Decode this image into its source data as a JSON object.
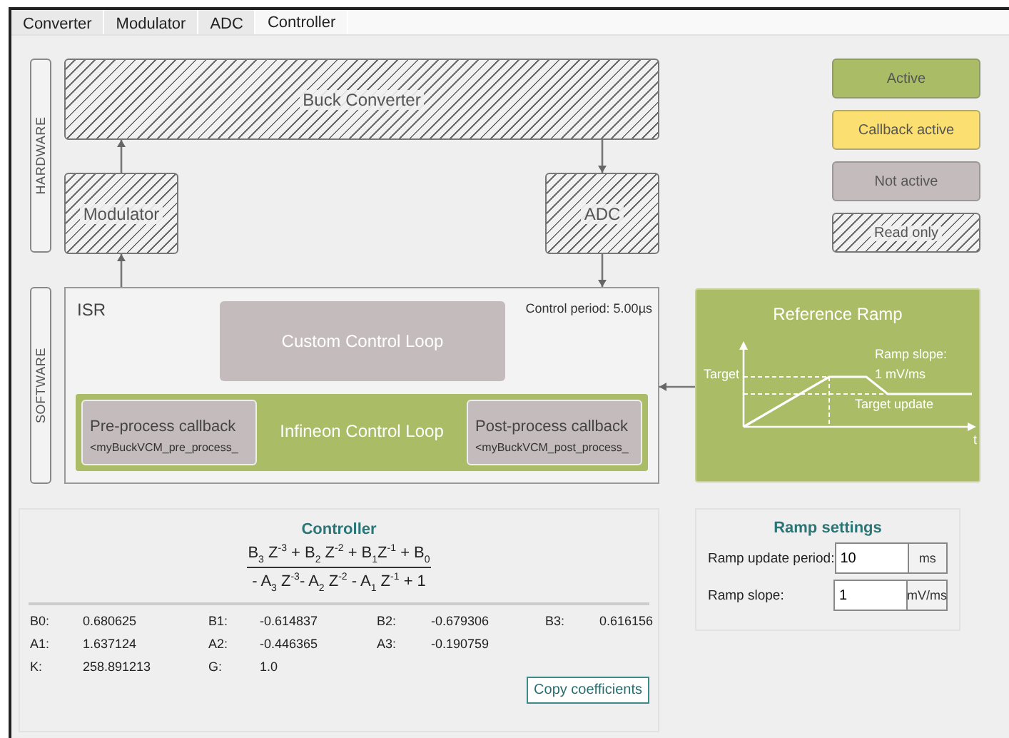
{
  "tabs": [
    {
      "label": "Converter",
      "selected": false
    },
    {
      "label": "Modulator",
      "selected": false
    },
    {
      "label": "ADC",
      "selected": false
    },
    {
      "label": "Controller",
      "selected": true
    }
  ],
  "hardware_label": "HARDWARE",
  "software_label": "SOFTWARE",
  "buck_converter": {
    "label": "Buck Converter",
    "kind": "readonly"
  },
  "modulator": {
    "label": "Modulator",
    "kind": "readonly"
  },
  "adc": {
    "label": "ADC",
    "kind": "readonly"
  },
  "legend": [
    {
      "label": "Active",
      "kind": "active"
    },
    {
      "label": "Callback active",
      "kind": "callback"
    },
    {
      "label": "Not active",
      "kind": "inactive"
    },
    {
      "label": "Read only",
      "kind": "readonly"
    }
  ],
  "isr": {
    "label": "ISR",
    "control_period": "Control period: 5.00µs",
    "custom_loop": {
      "label": "Custom Control Loop",
      "kind": "inactive"
    },
    "infineon_loop": {
      "label": "Infineon Control Loop",
      "kind": "active"
    },
    "pre_callback": {
      "title": "Pre-process callback",
      "function": "<myBuckVCM_pre_process_",
      "kind": "inactive"
    },
    "post_callback": {
      "title": "Post-process callback",
      "function": "<myBuckVCM_post_process_",
      "kind": "inactive"
    }
  },
  "reference_ramp": {
    "title": "Reference Ramp",
    "target_label": "Target",
    "slope_label": "Ramp slope:",
    "slope_value": "1 mV/ms",
    "update_label": "Target update",
    "axis_label": "t"
  },
  "controller": {
    "title": "Controller",
    "numerator": "B$_{3}$ Z$^{-3}$ + B$_{2}$ Z$^{-2}$ + B$_{1}$Z$^{-1}$ + B$_{0}$",
    "denominator": "- A$_{3}$ Z$^{-3}$- A$_{2}$ Z$^{-2}$ - A$_{1}$ Z$^{-1}$ + 1",
    "rows": [
      [
        {
          "label": "B0:",
          "value": "0.680625"
        },
        {
          "label": "B1:",
          "value": "-0.614837"
        },
        {
          "label": "B2:",
          "value": "-0.679306"
        },
        {
          "label": "B3:",
          "value": "0.616156"
        }
      ],
      [
        {
          "label": "A1:",
          "value": "1.637124"
        },
        {
          "label": "A2:",
          "value": "-0.446365"
        },
        {
          "label": "A3:",
          "value": "-0.190759"
        }
      ],
      [
        {
          "label": "K:",
          "value": "258.891213"
        },
        {
          "label": "G:",
          "value": "1.0"
        }
      ]
    ],
    "copy_button": "Copy coefficients"
  },
  "ramp_settings": {
    "title": "Ramp settings",
    "fields": [
      {
        "label": "Ramp update period:",
        "value": "10",
        "unit": "ms"
      },
      {
        "label": "Ramp slope:",
        "value": "1",
        "unit": "mV/ms"
      }
    ]
  }
}
